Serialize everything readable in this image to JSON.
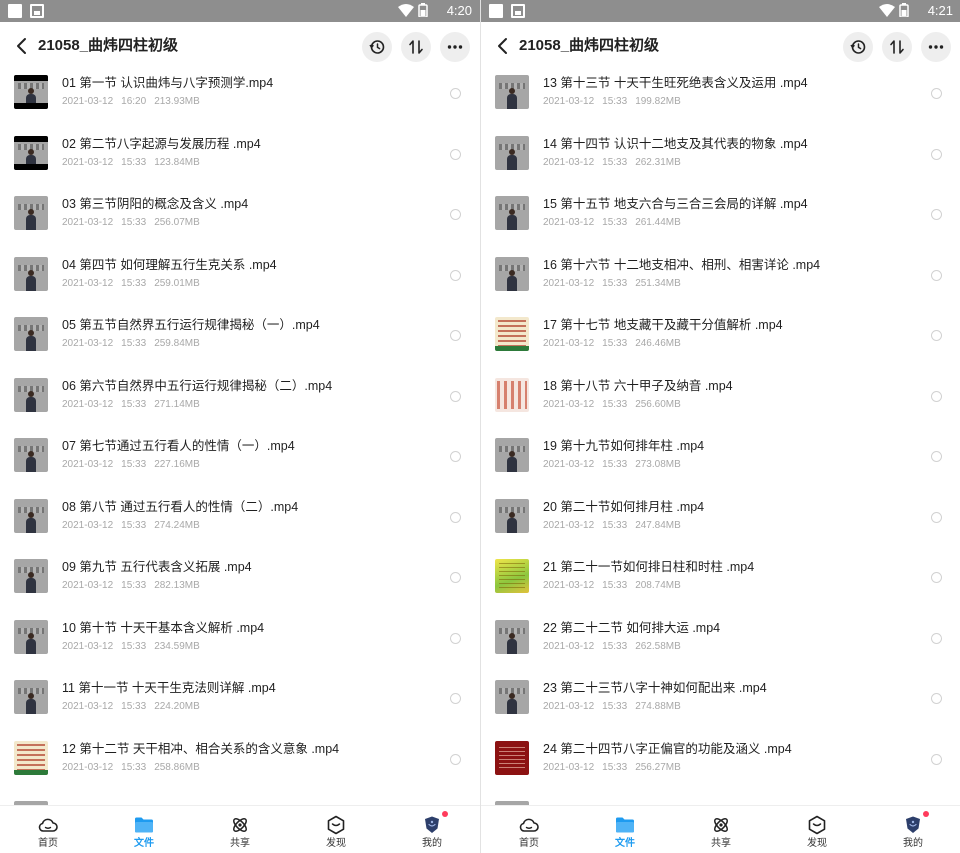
{
  "panes": [
    {
      "status": {
        "time": "4:20"
      },
      "header": {
        "title": "21058_曲炜四柱初级"
      },
      "files": [
        {
          "name": "01 第一节 认识曲炜与八字预测学.mp4",
          "date": "2021-03-12",
          "time": "16:20",
          "size": "213.93MB",
          "thumb": "video-letterbox"
        },
        {
          "name": "02 第二节八字起源与发展历程 .mp4",
          "date": "2021-03-12",
          "time": "15:33",
          "size": "123.84MB",
          "thumb": "video-letterbox"
        },
        {
          "name": "03 第三节阴阳的概念及含义 .mp4",
          "date": "2021-03-12",
          "time": "15:33",
          "size": "256.07MB",
          "thumb": "video"
        },
        {
          "name": "04 第四节 如何理解五行生克关系 .mp4",
          "date": "2021-03-12",
          "time": "15:33",
          "size": "259.01MB",
          "thumb": "video"
        },
        {
          "name": "05 第五节自然界五行运行规律揭秘（一）.mp4",
          "date": "2021-03-12",
          "time": "15:33",
          "size": "259.84MB",
          "thumb": "video"
        },
        {
          "name": "06 第六节自然界中五行运行规律揭秘（二）.mp4",
          "date": "2021-03-12",
          "time": "15:33",
          "size": "271.14MB",
          "thumb": "video"
        },
        {
          "name": "07 第七节通过五行看人的性情（一）.mp4",
          "date": "2021-03-12",
          "time": "15:33",
          "size": "227.16MB",
          "thumb": "video"
        },
        {
          "name": "08 第八节 通过五行看人的性情（二）.mp4",
          "date": "2021-03-12",
          "time": "15:33",
          "size": "274.24MB",
          "thumb": "video"
        },
        {
          "name": "09 第九节 五行代表含义拓展 .mp4",
          "date": "2021-03-12",
          "time": "15:33",
          "size": "282.13MB",
          "thumb": "video"
        },
        {
          "name": "10 第十节 十天干基本含义解析 .mp4",
          "date": "2021-03-12",
          "time": "15:33",
          "size": "234.59MB",
          "thumb": "video"
        },
        {
          "name": "11 第十一节 十天干生克法则详解 .mp4",
          "date": "2021-03-12",
          "time": "15:33",
          "size": "224.20MB",
          "thumb": "video"
        },
        {
          "name": "12 第十二节 天干相冲、相合关系的含义意象 .mp4",
          "date": "2021-03-12",
          "time": "15:33",
          "size": "258.86MB",
          "thumb": "doc"
        }
      ],
      "tabs": [
        {
          "label": "首页",
          "icon": "cloud-icon",
          "active": false
        },
        {
          "label": "文件",
          "icon": "folder-icon",
          "active": true
        },
        {
          "label": "共享",
          "icon": "share-icon",
          "active": false
        },
        {
          "label": "发现",
          "icon": "discover-icon",
          "active": false
        },
        {
          "label": "我的",
          "icon": "profile-icon",
          "active": false,
          "badge": true
        }
      ]
    },
    {
      "status": {
        "time": "4:21"
      },
      "header": {
        "title": "21058_曲炜四柱初级"
      },
      "files": [
        {
          "name": "13 第十三节 十天干生旺死绝表含义及运用 .mp4",
          "date": "2021-03-12",
          "time": "15:33",
          "size": "199.82MB",
          "thumb": "video"
        },
        {
          "name": "14 第十四节 认识十二地支及其代表的物象 .mp4",
          "date": "2021-03-12",
          "time": "15:33",
          "size": "262.31MB",
          "thumb": "video"
        },
        {
          "name": "15 第十五节 地支六合与三合三会局的详解 .mp4",
          "date": "2021-03-12",
          "time": "15:33",
          "size": "261.44MB",
          "thumb": "video"
        },
        {
          "name": "16 第十六节 十二地支相冲、相刑、相害详论 .mp4",
          "date": "2021-03-12",
          "time": "15:33",
          "size": "251.34MB",
          "thumb": "video"
        },
        {
          "name": "17 第十七节 地支藏干及藏干分值解析 .mp4",
          "date": "2021-03-12",
          "time": "15:33",
          "size": "246.46MB",
          "thumb": "doc"
        },
        {
          "name": "18 第十八节 六十甲子及纳音 .mp4",
          "date": "2021-03-12",
          "time": "15:33",
          "size": "256.60MB",
          "thumb": "doc2"
        },
        {
          "name": "19 第十九节如何排年柱 .mp4",
          "date": "2021-03-12",
          "time": "15:33",
          "size": "273.08MB",
          "thumb": "video"
        },
        {
          "name": "20 第二十节如何排月柱 .mp4",
          "date": "2021-03-12",
          "time": "15:33",
          "size": "247.84MB",
          "thumb": "video"
        },
        {
          "name": "21 第二十一节如何排日柱和时柱 .mp4",
          "date": "2021-03-12",
          "time": "15:33",
          "size": "208.74MB",
          "thumb": "yellow"
        },
        {
          "name": "22 第二十二节 如何排大运 .mp4",
          "date": "2021-03-12",
          "time": "15:33",
          "size": "262.58MB",
          "thumb": "video"
        },
        {
          "name": "23 第二十三节八字十神如何配出来 .mp4",
          "date": "2021-03-12",
          "time": "15:33",
          "size": "274.88MB",
          "thumb": "video"
        },
        {
          "name": "24 第二十四节八字正偏官的功能及涵义 .mp4",
          "date": "2021-03-12",
          "time": "15:33",
          "size": "256.27MB",
          "thumb": "red"
        }
      ],
      "tabs": [
        {
          "label": "首页",
          "icon": "cloud-icon",
          "active": false
        },
        {
          "label": "文件",
          "icon": "folder-icon",
          "active": true
        },
        {
          "label": "共享",
          "icon": "share-icon",
          "active": false
        },
        {
          "label": "发现",
          "icon": "discover-icon",
          "active": false
        },
        {
          "label": "我的",
          "icon": "profile-icon",
          "active": false,
          "badge": true
        }
      ]
    }
  ],
  "colors": {
    "accent": "#1e9bf0",
    "badge": "#ff3b5c",
    "meta": "#a8a8a8"
  }
}
